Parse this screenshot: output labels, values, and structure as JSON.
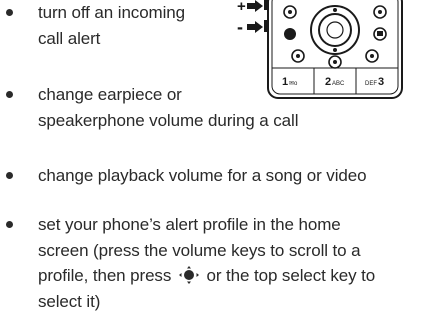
{
  "bullets": [
    {
      "lines": [
        "turn off an incoming",
        "call alert"
      ]
    },
    {
      "lines": [
        "change earpiece or",
        "speakerphone volume during a call"
      ]
    },
    {
      "lines": [
        "change playback volume for a song or video"
      ]
    },
    {
      "lines": [
        "set your phone’s alert profile in the home",
        "screen (press the volume keys to scroll to a"
      ],
      "line3_before": "profile, then press",
      "line3_after": "or the top select key to",
      "line4": "select it)"
    }
  ],
  "phone": {
    "plus_label": "+",
    "minus_label": "-",
    "key1": "1",
    "key1_sub": "✉o",
    "key2": "2",
    "key2_sub": "ABC",
    "key3": "3",
    "key3_sub": "DEF"
  },
  "icons": {
    "nav_key": "navigation-key-icon",
    "arrow": "arrow-right-icon"
  }
}
